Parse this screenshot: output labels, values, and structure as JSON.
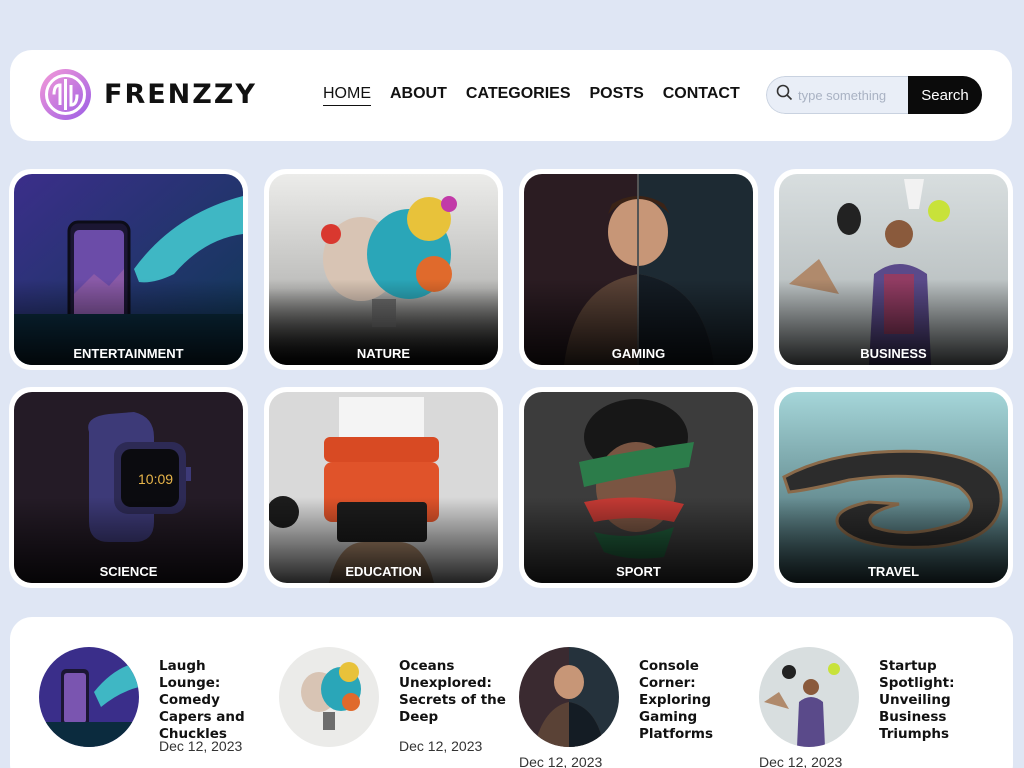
{
  "brand": {
    "name": "FRENZZY",
    "logo_icon": "frenzzy-logo-icon"
  },
  "nav": {
    "items": [
      {
        "label": "HOME",
        "active": true
      },
      {
        "label": "ABOUT",
        "active": false
      },
      {
        "label": "CATEGORIES",
        "active": false
      },
      {
        "label": "POSTS",
        "active": false
      },
      {
        "label": "CONTACT",
        "active": false
      }
    ]
  },
  "search": {
    "placeholder": "type something",
    "value": "",
    "button_label": "Search",
    "icon": "search-icon"
  },
  "categories": [
    {
      "label": "ENTERTAINMENT"
    },
    {
      "label": "NATURE"
    },
    {
      "label": "GAMING"
    },
    {
      "label": "BUSINESS"
    },
    {
      "label": "SCIENCE"
    },
    {
      "label": "EDUCATION"
    },
    {
      "label": "SPORT"
    },
    {
      "label": "TRAVEL"
    }
  ],
  "posts": [
    {
      "title": "Laugh Lounge: Comedy Capers and Chuckles",
      "date": "Dec 12, 2023"
    },
    {
      "title": "Oceans Unexplored: Secrets of the Deep",
      "date": "Dec 12, 2023"
    },
    {
      "title": "Console Corner: Exploring Gaming Platforms",
      "date": "Dec 12, 2023"
    },
    {
      "title": "Startup Spotlight: Unveiling Business Triumphs",
      "date": "Dec 12, 2023"
    }
  ],
  "colors": {
    "background": "#dfe6f4",
    "panel": "#ffffff",
    "button": "#0b0b0b",
    "logo_gradient": [
      "#f59ad8",
      "#9b5de5"
    ]
  }
}
